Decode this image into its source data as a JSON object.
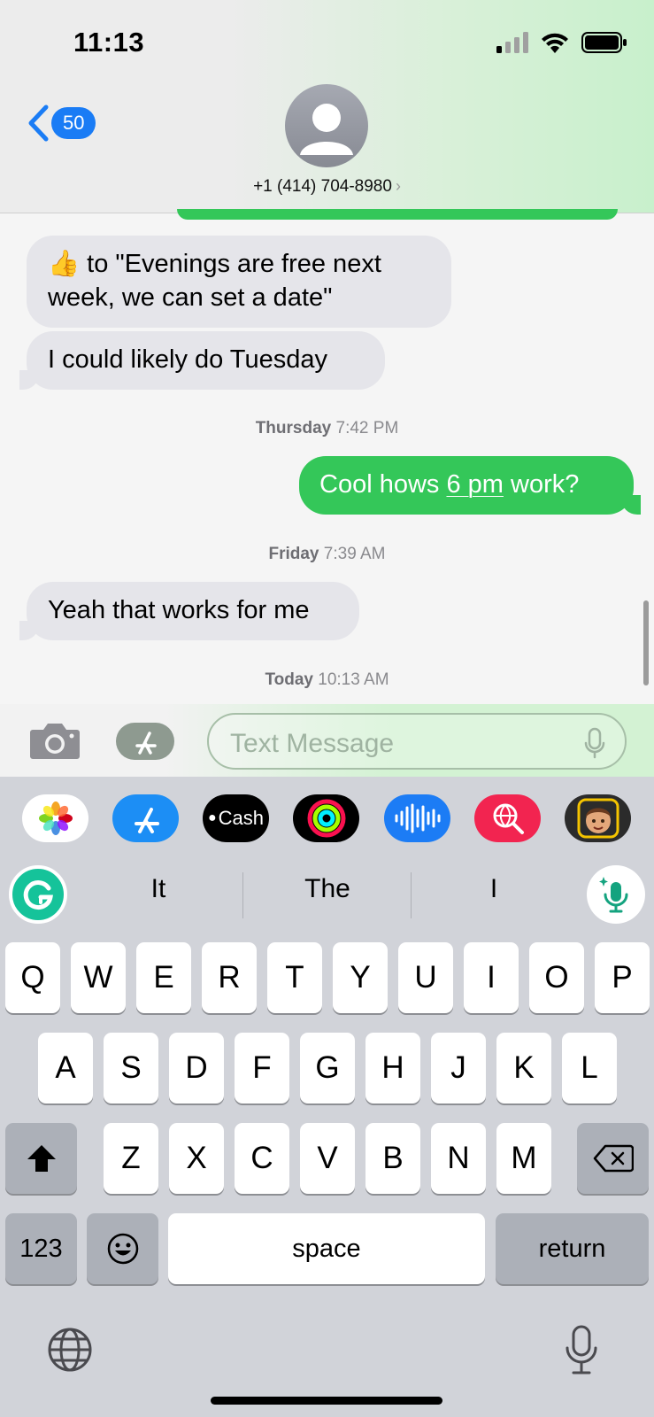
{
  "status": {
    "time": "11:13"
  },
  "header": {
    "back_count": "50",
    "contact": "+1 (414) 704-8980",
    "chevron": "›"
  },
  "messages": {
    "m1_reaction": "👍",
    "m1_text_line1": " to \"Evenings are free next",
    "m1_text_line2": "week, we can set a date\"",
    "m2": "I could likely do Tuesday",
    "ts1_day": "Thursday",
    "ts1_time": "7:42 PM",
    "m3_before": "Cool hows ",
    "m3_link": "6 pm",
    "m3_after": " work?",
    "ts2_day": "Friday",
    "ts2_time": "7:39 AM",
    "m4": "Yeah that works for me",
    "ts3_day": "Today",
    "ts3_time": "10:13 AM"
  },
  "compose": {
    "placeholder": "Text Message"
  },
  "apps": {
    "cash_label": "Cash"
  },
  "suggestions": [
    "It",
    "The",
    "I"
  ],
  "keyboard": {
    "row1": [
      "Q",
      "W",
      "E",
      "R",
      "T",
      "Y",
      "U",
      "I",
      "O",
      "P"
    ],
    "row2": [
      "A",
      "S",
      "D",
      "F",
      "G",
      "H",
      "J",
      "K",
      "L"
    ],
    "row3": [
      "Z",
      "X",
      "C",
      "V",
      "B",
      "N",
      "M"
    ],
    "numbers": "123",
    "space": "space",
    "return": "return"
  },
  "colors": {
    "sent": "#34c759",
    "received": "#e5e5ea",
    "badge": "#1a7cf5"
  }
}
